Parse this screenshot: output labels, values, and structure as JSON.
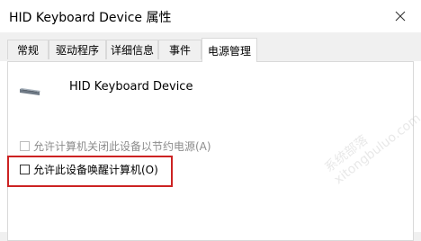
{
  "window": {
    "title": "HID Keyboard Device 属性"
  },
  "tabs": [
    {
      "label": "常规"
    },
    {
      "label": "驱动程序"
    },
    {
      "label": "详细信息"
    },
    {
      "label": "事件"
    },
    {
      "label": "电源管理"
    }
  ],
  "device": {
    "name": "HID Keyboard Device",
    "icon": "keyboard-icon"
  },
  "options": {
    "allow_turn_off": {
      "label": "允许计算机关闭此设备以节约电源(A)",
      "checked": false,
      "enabled": false
    },
    "allow_wake": {
      "label": "允许此设备唤醒计算机(O)",
      "checked": false,
      "enabled": true
    }
  },
  "watermark": {
    "lines": [
      "系统部落",
      "xitongbuluo.com"
    ]
  },
  "colors": {
    "highlight_border": "#cc2222"
  }
}
